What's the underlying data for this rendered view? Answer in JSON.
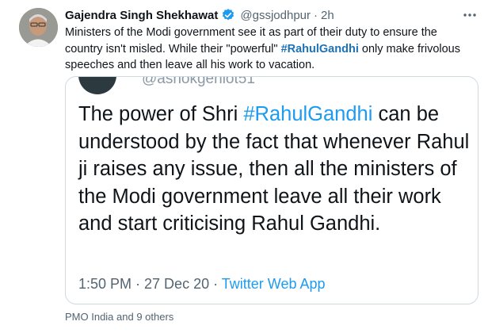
{
  "tweet": {
    "author_name": "Gajendra Singh Shekhawat",
    "handle": "@gssjodhpur",
    "separator": "·",
    "time": "2h",
    "text_part1": "Ministers of the Modi government see it as part of their duty to ensure the country isn't misled. While their \"powerful\" ",
    "hashtag": "#RahulGandhi",
    "text_part2": " only make frivolous speeches and then leave all his work to vacation.",
    "more_label": "⋯",
    "verified_color": "#1d9bf0"
  },
  "quote": {
    "handle_fragment": "@ashokgehlot51",
    "text_part1": "The power of Shri ",
    "hashtag": "#RahulGandhi",
    "text_part2": " can be understood by the fact that whenever Rahul ji raises any issue, then all the ministers of the Modi government leave all their work and start criticising Rahul Gandhi.",
    "time": "1:50 PM · 27 Dec 20",
    "separator": " · ",
    "source": "Twitter Web App"
  },
  "footer": {
    "liked_by": "PMO India and 9 others"
  }
}
